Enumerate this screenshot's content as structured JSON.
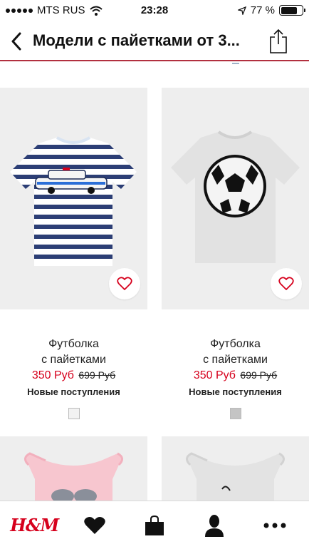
{
  "status_bar": {
    "carrier": "MTS RUS",
    "time": "23:28",
    "battery": "77 %",
    "battery_level": 0.77
  },
  "header": {
    "title": "Модели с пайетками от 3..."
  },
  "products": [
    {
      "name_line1": "Футболка",
      "name_line2": "с пайетками",
      "price": "350 Руб",
      "old_price": "699 Руб",
      "badge": "Новые поступления",
      "swatch_color": "#f2f2f2"
    },
    {
      "name_line1": "Футболка",
      "name_line2": "с пайетками",
      "price": "350 Руб",
      "old_price": "699 Руб",
      "badge": "Новые поступления",
      "swatch_color": "#c4c4c4"
    }
  ],
  "bottom_nav": {
    "logo": "H&M",
    "items": [
      "home-logo",
      "heart-icon",
      "bag-icon",
      "user-icon",
      "more-icon"
    ]
  },
  "colors": {
    "accent": "#d6001c",
    "header_border": "#b2303f"
  }
}
